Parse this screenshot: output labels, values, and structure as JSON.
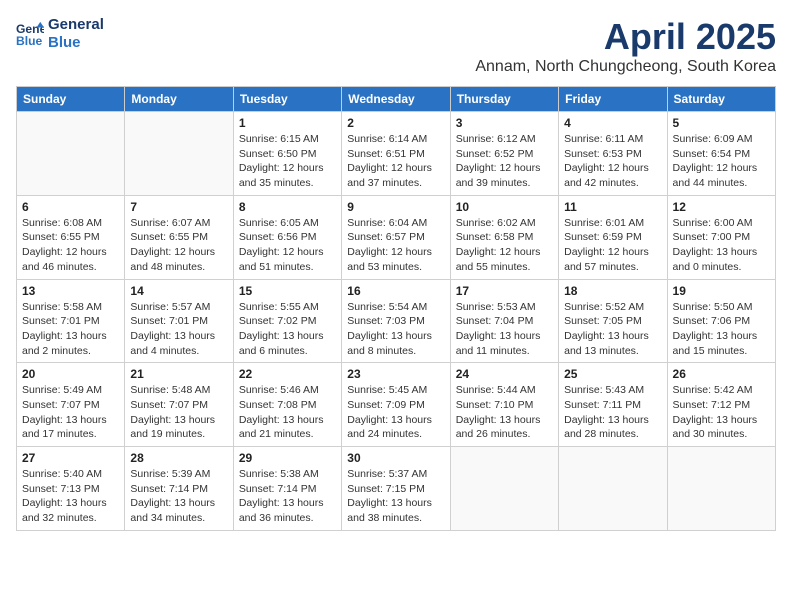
{
  "header": {
    "logo_line1": "General",
    "logo_line2": "Blue",
    "month_title": "April 2025",
    "subtitle": "Annam, North Chungcheong, South Korea"
  },
  "days_of_week": [
    "Sunday",
    "Monday",
    "Tuesday",
    "Wednesday",
    "Thursday",
    "Friday",
    "Saturday"
  ],
  "weeks": [
    [
      {
        "day": "",
        "detail": ""
      },
      {
        "day": "",
        "detail": ""
      },
      {
        "day": "1",
        "detail": "Sunrise: 6:15 AM\nSunset: 6:50 PM\nDaylight: 12 hours and 35 minutes."
      },
      {
        "day": "2",
        "detail": "Sunrise: 6:14 AM\nSunset: 6:51 PM\nDaylight: 12 hours and 37 minutes."
      },
      {
        "day": "3",
        "detail": "Sunrise: 6:12 AM\nSunset: 6:52 PM\nDaylight: 12 hours and 39 minutes."
      },
      {
        "day": "4",
        "detail": "Sunrise: 6:11 AM\nSunset: 6:53 PM\nDaylight: 12 hours and 42 minutes."
      },
      {
        "day": "5",
        "detail": "Sunrise: 6:09 AM\nSunset: 6:54 PM\nDaylight: 12 hours and 44 minutes."
      }
    ],
    [
      {
        "day": "6",
        "detail": "Sunrise: 6:08 AM\nSunset: 6:55 PM\nDaylight: 12 hours and 46 minutes."
      },
      {
        "day": "7",
        "detail": "Sunrise: 6:07 AM\nSunset: 6:55 PM\nDaylight: 12 hours and 48 minutes."
      },
      {
        "day": "8",
        "detail": "Sunrise: 6:05 AM\nSunset: 6:56 PM\nDaylight: 12 hours and 51 minutes."
      },
      {
        "day": "9",
        "detail": "Sunrise: 6:04 AM\nSunset: 6:57 PM\nDaylight: 12 hours and 53 minutes."
      },
      {
        "day": "10",
        "detail": "Sunrise: 6:02 AM\nSunset: 6:58 PM\nDaylight: 12 hours and 55 minutes."
      },
      {
        "day": "11",
        "detail": "Sunrise: 6:01 AM\nSunset: 6:59 PM\nDaylight: 12 hours and 57 minutes."
      },
      {
        "day": "12",
        "detail": "Sunrise: 6:00 AM\nSunset: 7:00 PM\nDaylight: 13 hours and 0 minutes."
      }
    ],
    [
      {
        "day": "13",
        "detail": "Sunrise: 5:58 AM\nSunset: 7:01 PM\nDaylight: 13 hours and 2 minutes."
      },
      {
        "day": "14",
        "detail": "Sunrise: 5:57 AM\nSunset: 7:01 PM\nDaylight: 13 hours and 4 minutes."
      },
      {
        "day": "15",
        "detail": "Sunrise: 5:55 AM\nSunset: 7:02 PM\nDaylight: 13 hours and 6 minutes."
      },
      {
        "day": "16",
        "detail": "Sunrise: 5:54 AM\nSunset: 7:03 PM\nDaylight: 13 hours and 8 minutes."
      },
      {
        "day": "17",
        "detail": "Sunrise: 5:53 AM\nSunset: 7:04 PM\nDaylight: 13 hours and 11 minutes."
      },
      {
        "day": "18",
        "detail": "Sunrise: 5:52 AM\nSunset: 7:05 PM\nDaylight: 13 hours and 13 minutes."
      },
      {
        "day": "19",
        "detail": "Sunrise: 5:50 AM\nSunset: 7:06 PM\nDaylight: 13 hours and 15 minutes."
      }
    ],
    [
      {
        "day": "20",
        "detail": "Sunrise: 5:49 AM\nSunset: 7:07 PM\nDaylight: 13 hours and 17 minutes."
      },
      {
        "day": "21",
        "detail": "Sunrise: 5:48 AM\nSunset: 7:07 PM\nDaylight: 13 hours and 19 minutes."
      },
      {
        "day": "22",
        "detail": "Sunrise: 5:46 AM\nSunset: 7:08 PM\nDaylight: 13 hours and 21 minutes."
      },
      {
        "day": "23",
        "detail": "Sunrise: 5:45 AM\nSunset: 7:09 PM\nDaylight: 13 hours and 24 minutes."
      },
      {
        "day": "24",
        "detail": "Sunrise: 5:44 AM\nSunset: 7:10 PM\nDaylight: 13 hours and 26 minutes."
      },
      {
        "day": "25",
        "detail": "Sunrise: 5:43 AM\nSunset: 7:11 PM\nDaylight: 13 hours and 28 minutes."
      },
      {
        "day": "26",
        "detail": "Sunrise: 5:42 AM\nSunset: 7:12 PM\nDaylight: 13 hours and 30 minutes."
      }
    ],
    [
      {
        "day": "27",
        "detail": "Sunrise: 5:40 AM\nSunset: 7:13 PM\nDaylight: 13 hours and 32 minutes."
      },
      {
        "day": "28",
        "detail": "Sunrise: 5:39 AM\nSunset: 7:14 PM\nDaylight: 13 hours and 34 minutes."
      },
      {
        "day": "29",
        "detail": "Sunrise: 5:38 AM\nSunset: 7:14 PM\nDaylight: 13 hours and 36 minutes."
      },
      {
        "day": "30",
        "detail": "Sunrise: 5:37 AM\nSunset: 7:15 PM\nDaylight: 13 hours and 38 minutes."
      },
      {
        "day": "",
        "detail": ""
      },
      {
        "day": "",
        "detail": ""
      },
      {
        "day": "",
        "detail": ""
      }
    ]
  ]
}
